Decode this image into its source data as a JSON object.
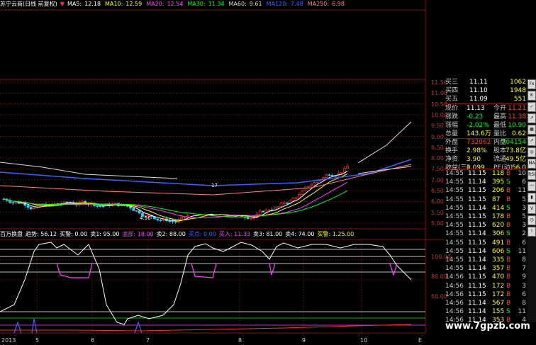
{
  "header": {
    "title": "苏宁云商(日线 前复权)",
    "ma": [
      {
        "label": "MA5:",
        "value": "12.18",
        "color": "#ffffff"
      },
      {
        "label": "MA10:",
        "value": "12.59",
        "color": "#ffff00"
      },
      {
        "label": "MA20:",
        "value": "12.54",
        "color": "#ff40ff"
      },
      {
        "label": "MA30:",
        "value": "11.34",
        "color": "#00ff00"
      },
      {
        "label": "MA60:",
        "value": "9.61",
        "color": "#dddddd"
      },
      {
        "label": "MA120:",
        "value": "7.48",
        "color": "#4060ff"
      },
      {
        "label": "MA250:",
        "value": "6.98",
        "color": "#ff8080"
      }
    ]
  },
  "price_axis": [
    "11.50",
    "11.00",
    "10.50",
    "10.00",
    "9.50",
    "9.00",
    "8.50",
    "8.00",
    "7.50",
    "7.00",
    "6.50",
    "6.00",
    "5.50",
    "5.00"
  ],
  "indicator_axis": [
    "100.00",
    "80.00",
    "60.00"
  ],
  "annotations": {
    "high": "17",
    "low": "4.56"
  },
  "indicator": {
    "items": [
      {
        "text": "百万换盘",
        "color": "#ffffff"
      },
      {
        "text": "趋势: 56.12",
        "color": "#ffffff"
      },
      {
        "text": "买警: 0.00",
        "color": "#ffffff"
      },
      {
        "text": "卖1: 95.00",
        "color": "#ffffff"
      },
      {
        "text": "底部: 18.00",
        "color": "#ff40ff"
      },
      {
        "text": "卖2: 88.00",
        "color": "#ffffff"
      },
      {
        "text": "买点: 0.00",
        "color": "#4060ff"
      },
      {
        "text": "买入: 11.33",
        "color": "#ff40ff"
      },
      {
        "text": "卖3: 81.00",
        "color": "#ffffff"
      },
      {
        "text": "卖4: 74.00",
        "color": "#ffffff"
      },
      {
        "text": "买警: 1.25.00",
        "color": "#ffff00"
      }
    ]
  },
  "quote": {
    "order_book": [
      {
        "label": "买三",
        "price": "11.11",
        "vol": "1062"
      },
      {
        "label": "买四",
        "price": "11.10",
        "vol": "1948"
      },
      {
        "label": "买五",
        "price": "11.09",
        "vol": "551"
      }
    ],
    "stats": [
      {
        "l1": "现价",
        "v1": "11.13",
        "c1": "#ffffff",
        "l2": "今开",
        "v2": "11.21",
        "c2": "#ff4040"
      },
      {
        "l1": "涨跌",
        "v1": "-0.23",
        "c1": "#00ff00",
        "l2": "最高",
        "v2": "11.38",
        "c2": "#ff4040"
      },
      {
        "l1": "涨幅",
        "v1": "-2.02%",
        "c1": "#00ff00",
        "l2": "最低",
        "v2": "10.90",
        "c2": "#00ff00"
      },
      {
        "l1": "总量",
        "v1": "143.6万",
        "c1": "#ffff00",
        "l2": "量比",
        "v2": "0.62",
        "c2": "#ffff00"
      },
      {
        "l1": "外盘",
        "v1": "732062",
        "c1": "#ff4040",
        "l2": "内盘",
        "v2": "704154",
        "c2": "#00ff00"
      },
      {
        "l1": "换手",
        "v1": "2.98%",
        "c1": "#ffff00",
        "l2": "股本",
        "v2": "73.8亿",
        "c2": "#ffff00"
      },
      {
        "l1": "净资",
        "v1": "3.90",
        "c1": "#ffff00",
        "l2": "流通",
        "v2": "49.5亿",
        "c2": "#ffff00"
      },
      {
        "l1": "收益(三)",
        "v1": "0.099",
        "c1": "#ffff00",
        "l2": "PE(动)",
        "v2": "56.0",
        "c2": "#ffff00"
      }
    ],
    "ticks": [
      {
        "time": "14:55",
        "price": "11.15",
        "vol": "118",
        "dir": "B",
        "n": "10"
      },
      {
        "time": "14:55",
        "price": "11.14",
        "vol": "395",
        "dir": "S",
        "n": "6"
      },
      {
        "time": "14:55",
        "price": "11.15",
        "vol": "206",
        "dir": "B",
        "n": "11"
      },
      {
        "time": "14:55",
        "price": "11.15",
        "vol": "87",
        "dir": "B",
        "n": "5"
      },
      {
        "time": "14:55",
        "price": "11.14",
        "vol": "414",
        "dir": "S",
        "n": "3"
      },
      {
        "time": "14:55",
        "price": "11.15",
        "vol": "178",
        "dir": "B",
        "n": "5"
      },
      {
        "time": "14:55",
        "price": "11.15",
        "vol": "620",
        "dir": "B",
        "n": "3"
      },
      {
        "time": "14:55",
        "price": "11.14",
        "vol": "306",
        "dir": "S",
        "n": "2"
      },
      {
        "time": "14:55",
        "price": "11.15",
        "vol": "491",
        "dir": "B",
        "n": "6"
      },
      {
        "time": "14:55",
        "price": "11.14",
        "vol": "606",
        "dir": "S",
        "n": "11"
      },
      {
        "time": "14:55",
        "price": "11.14",
        "vol": "335",
        "dir": "B",
        "n": "8"
      },
      {
        "time": "14:55",
        "price": "11.14",
        "vol": "357",
        "dir": "B",
        "n": "7"
      },
      {
        "time": "14:56",
        "price": "11.15",
        "vol": "470",
        "dir": "B",
        "n": "9"
      },
      {
        "time": "14:56",
        "price": "11.15",
        "vol": "172",
        "dir": "B",
        "n": "3"
      },
      {
        "time": "14:56",
        "price": "11.15",
        "vol": "172",
        "dir": "B",
        "n": "6"
      },
      {
        "time": "14:56",
        "price": "11.14",
        "vol": "567",
        "dir": "B",
        "n": "8"
      },
      {
        "time": "14:56",
        "price": "11.14",
        "vol": "155",
        "dir": "S",
        "n": "11"
      },
      {
        "time": "14:56",
        "price": "11.14",
        "vol": "353",
        "dir": "B",
        "n": "4"
      }
    ]
  },
  "dates": [
    "2013年",
    "5",
    "6",
    "7",
    "8",
    "9",
    "10"
  ],
  "corner": "E",
  "watermark": "www.7gpzb.com",
  "toolbar_icons": [
    "fx-icon",
    "chart-icon",
    "check-icon",
    "trend-icon",
    "grid-icon",
    "trend-icon",
    "zoom-icon",
    "macd-icon",
    "rsi-icon",
    "line-icon",
    "bar-icon",
    "volume-icon",
    "clock-icon",
    "signal-icon"
  ],
  "toolbar_labels": [
    "Fx",
    "K",
    "✓",
    "↗",
    "▦",
    "↗",
    "◎",
    "MA",
    "RSI",
    "〰",
    "▮",
    "V",
    "◷",
    "!"
  ]
}
